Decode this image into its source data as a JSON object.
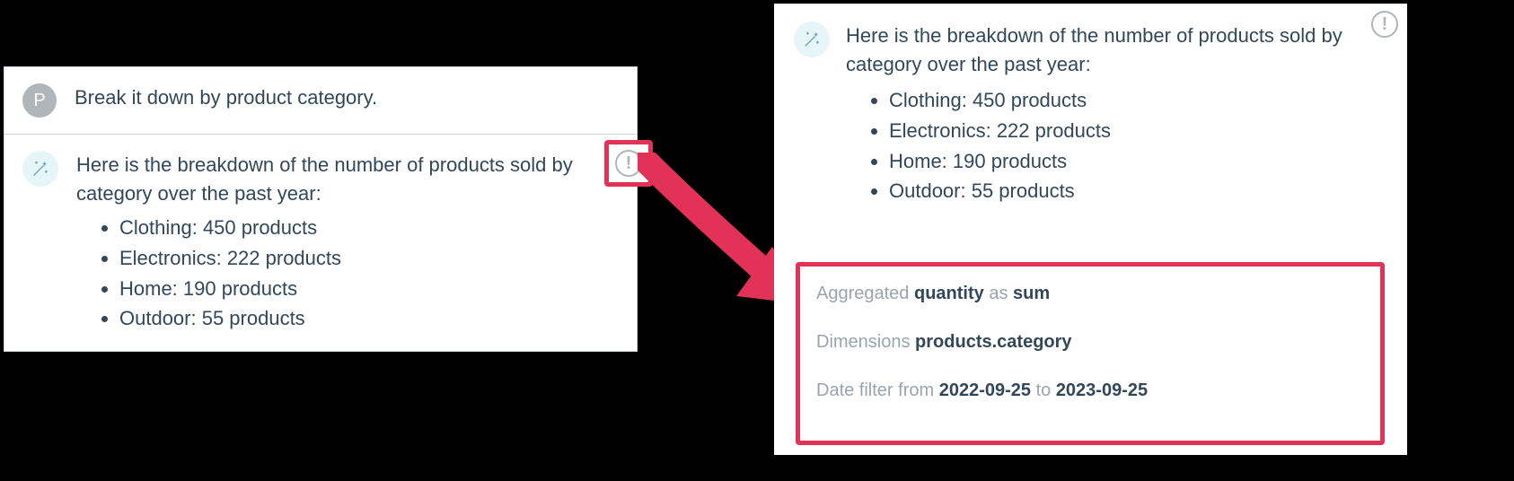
{
  "left": {
    "user_avatar_letter": "P",
    "user_message": "Break it down by product category.",
    "ai_intro": "Here is the breakdown of the number of products sold by category over the past year:",
    "breakdown": [
      "Clothing: 450 products",
      "Electronics: 222 products",
      "Home: 190 products",
      "Outdoor: 55 products"
    ],
    "info_glyph": "!"
  },
  "right": {
    "ai_intro": "Here is the breakdown of the number of products sold by category over the past year:",
    "breakdown": [
      "Clothing: 450 products",
      "Electronics: 222 products",
      "Home: 190 products",
      "Outdoor: 55 products"
    ],
    "info_glyph": "!",
    "details": {
      "agg_label": "Aggregated ",
      "agg_field": "quantity",
      "agg_mid": " as ",
      "agg_func": "sum",
      "dim_label": "Dimensions ",
      "dim_value": "products.category",
      "date_label": "Date filter from ",
      "date_from": "2022-09-25",
      "date_mid": " to ",
      "date_to": "2023-09-25"
    }
  }
}
